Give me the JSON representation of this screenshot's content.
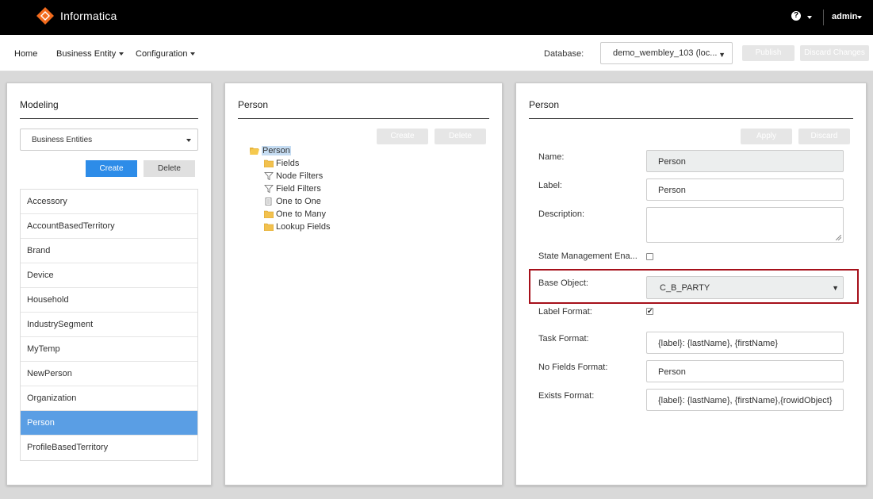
{
  "header": {
    "brand": "Informatica",
    "help_icon": "?",
    "user": "admin",
    "brand_color": "#f26b1d"
  },
  "nav": {
    "home": "Home",
    "business_entity": "Business Entity",
    "configuration": "Configuration",
    "database_label": "Database:",
    "database_value": "demo_wembley_103 (loc...",
    "publish": "Publish",
    "discard_changes": "Discard Changes"
  },
  "modeling": {
    "title": "Modeling",
    "selector": "Business Entities",
    "create": "Create",
    "delete": "Delete",
    "entities": [
      "Accessory",
      "AccountBasedTerritory",
      "Brand",
      "Device",
      "Household",
      "IndustrySegment",
      "MyTemp",
      "NewPerson",
      "Organization",
      "Person",
      "ProfileBasedTerritory"
    ],
    "selected": "Person"
  },
  "tree_panel": {
    "title": "Person",
    "create": "Create",
    "delete": "Delete",
    "root": "Person",
    "children": [
      {
        "label": "Fields",
        "icon": "folder-icon"
      },
      {
        "label": "Node Filters",
        "icon": "filter-icon"
      },
      {
        "label": "Field Filters",
        "icon": "filter-icon"
      },
      {
        "label": "One to One",
        "icon": "document-icon"
      },
      {
        "label": "One to Many",
        "icon": "folder-icon"
      },
      {
        "label": "Lookup Fields",
        "icon": "folder-icon"
      }
    ]
  },
  "detail": {
    "title": "Person",
    "apply": "Apply",
    "discard": "Discard",
    "name_label": "Name:",
    "name_value": "Person",
    "label_label": "Label:",
    "label_value": "Person",
    "description_label": "Description:",
    "description_value": "",
    "state_mgmt_label": "State Management Ena...",
    "state_mgmt_checked": false,
    "base_object_label": "Base Object:",
    "base_object_value": "C_B_PARTY",
    "label_format_label": "Label Format:",
    "label_format_checked": true,
    "task_format_label": "Task Format:",
    "task_format_value": "{label}: {lastName}, {firstName}",
    "no_fields_label": "No Fields Format:",
    "no_fields_value": "Person",
    "exists_label": "Exists Format:",
    "exists_value": "{label}: {lastName}, {firstName},{rowidObject}"
  }
}
